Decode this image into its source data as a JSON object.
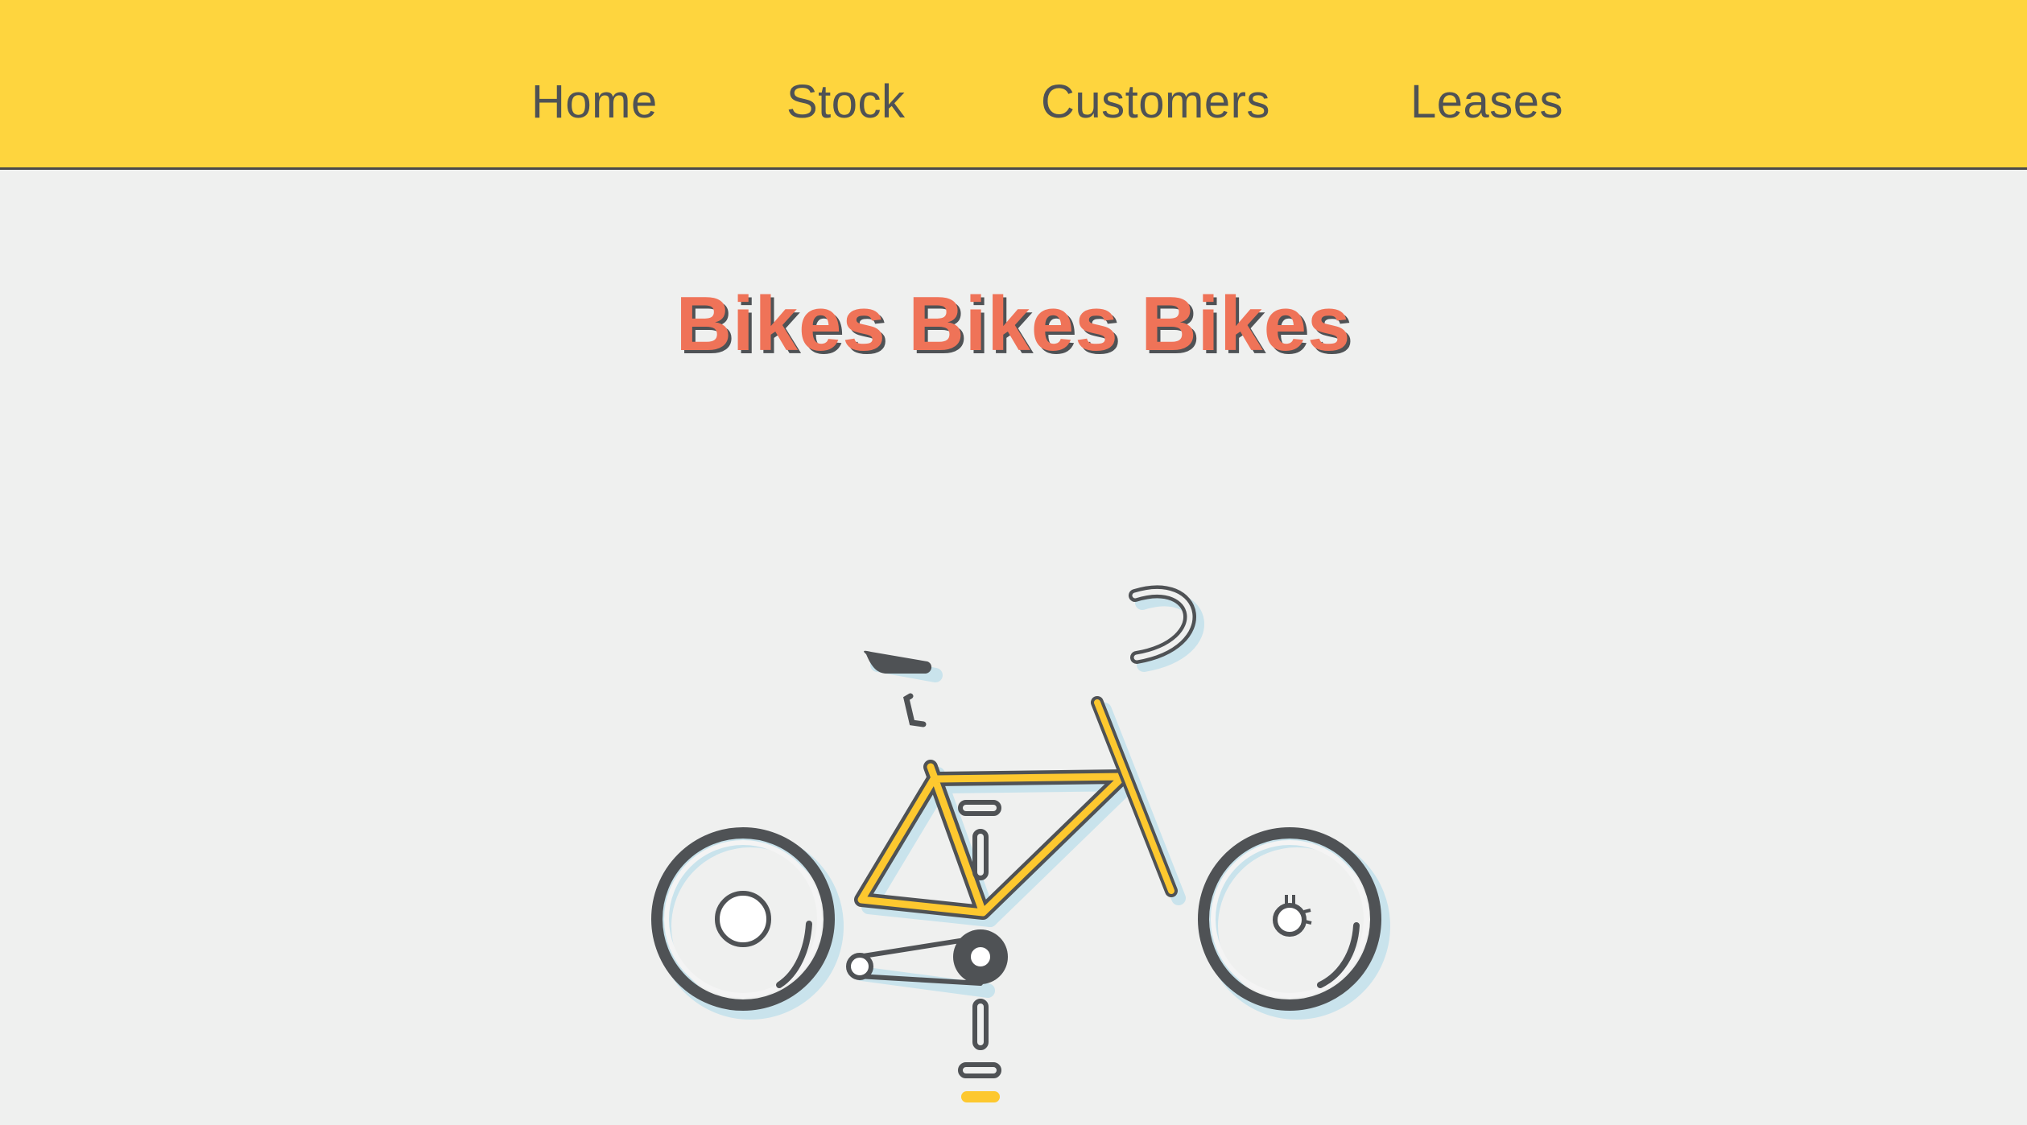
{
  "nav": {
    "items": [
      {
        "label": "Home"
      },
      {
        "label": "Stock"
      },
      {
        "label": "Customers"
      },
      {
        "label": "Leases"
      }
    ]
  },
  "main": {
    "title": "Bikes Bikes Bikes"
  },
  "colors": {
    "nav_background": "#fed53e",
    "page_background": "#eff0ef",
    "title": "#ef7358",
    "title_shadow": "#4f5255",
    "nav_text": "#4f5255",
    "bike_frame": "#fdc82f",
    "bike_outline": "#4f5255",
    "bike_shadow": "#c9e3ec"
  },
  "illustration": {
    "icon": "exploded-bicycle-icon"
  }
}
